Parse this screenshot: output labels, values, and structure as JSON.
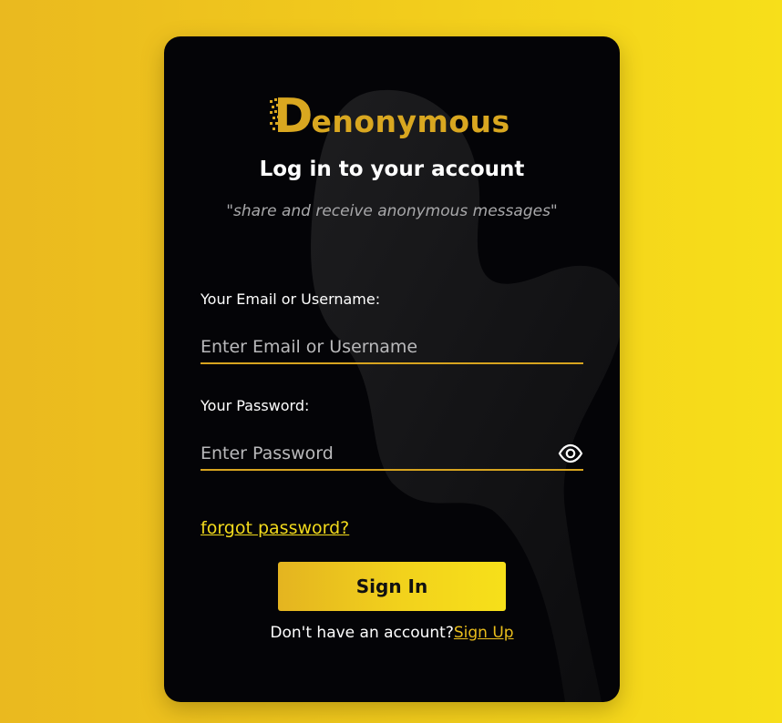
{
  "brand": {
    "logo_initial": "D",
    "logo_rest": "enonymous",
    "accent_color": "#d9a720",
    "link_color": "#f2da1c"
  },
  "header": {
    "title": "Log in to your account",
    "tagline": "\"share and receive anonymous messages\""
  },
  "form": {
    "email_label": "Your Email or Username:",
    "email_placeholder": "Enter Email or Username",
    "password_label": "Your Password:",
    "password_placeholder": "Enter Password",
    "password_toggle_icon": "eye-icon",
    "forgot_label": "forgot password?",
    "submit_label": "Sign In"
  },
  "footer": {
    "prompt": "Don't have an account?",
    "signup_label": "Sign Up"
  }
}
